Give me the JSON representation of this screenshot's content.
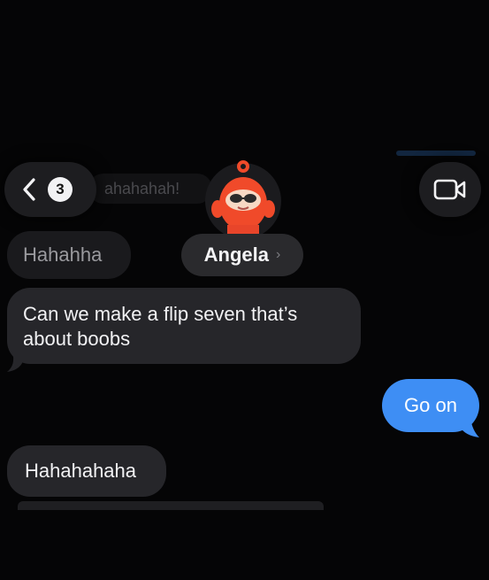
{
  "header": {
    "unread_count": "3",
    "previous_preview": "ahahahah!",
    "contact_name": "Angela",
    "name_chevron": "›"
  },
  "messages": [
    {
      "side": "received",
      "text": "Hahahha"
    },
    {
      "side": "received",
      "text": "Can we make a flip seven that’s about boobs"
    },
    {
      "side": "sent",
      "text": "Go on"
    },
    {
      "side": "received",
      "text": "Hahahahaha"
    }
  ],
  "colors": {
    "background": "#050506",
    "received_bubble": "#26262a",
    "sent_bubble": "#3e8ef4",
    "avatar_accent": "#f04a2a"
  },
  "icons": {
    "back": "chevron-left-icon",
    "video": "video-camera-icon"
  }
}
